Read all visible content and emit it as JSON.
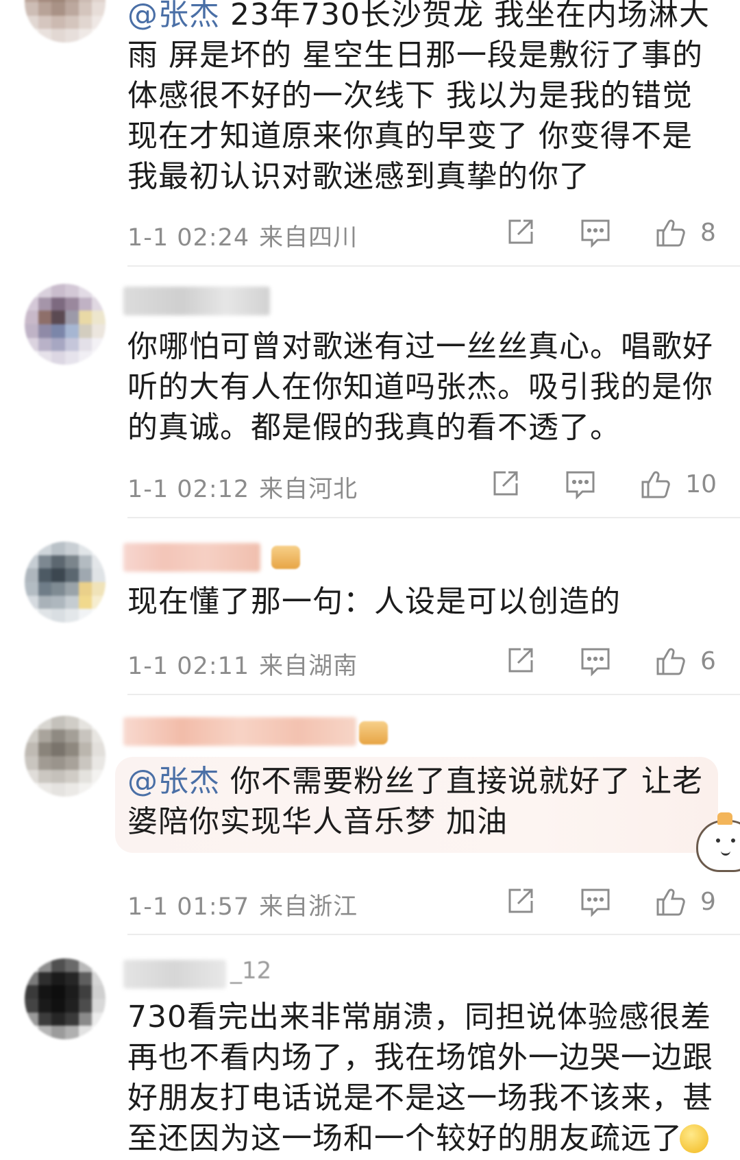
{
  "comments": [
    {
      "mention": "@张杰",
      "text": " 23年730长沙贺龙 我坐在内场淋大雨 屏是坏的 星空生日那一段是敷衍了事的体感很不好的一次线下 我以为是我的错觉现在才知道原来你真的早变了 你变得不是我最初认识对歌迷感到真挚的你了",
      "time": "1-1 02:24",
      "location": "来自四川",
      "likes": "8"
    },
    {
      "mention": "",
      "text": "你哪怕可曾对歌迷有过一丝丝真心。唱歌好听的大有人在你知道吗张杰。吸引我的是你的真诚。都是假的我真的看不透了。",
      "time": "1-1 02:12",
      "location": "来自河北",
      "likes": "10"
    },
    {
      "mention": "",
      "text": "现在懂了那一句：人设是可以创造的",
      "time": "1-1 02:11",
      "location": "来自湖南",
      "likes": "6"
    },
    {
      "mention": "@张杰",
      "text": " 你不需要粉丝了直接说就好了 让老婆陪你实现华人音乐梦 加油",
      "time": "1-1 01:57",
      "location": "来自浙江",
      "likes": "9"
    },
    {
      "mention": "",
      "username_suffix": "_12",
      "text": "730看完出来非常崩溃，同担说体验感很差再也不看内场了，我在场馆外一边哭一边跟好朋友打电话说是不是这一场我不该来，甚至还因为这一场和一个较好的朋友疏远了",
      "time": "",
      "location": "",
      "likes": ""
    }
  ],
  "icons": {
    "repost": "repost-icon",
    "comment": "comment-icon",
    "like": "thumbs-up-icon"
  },
  "colors": {
    "mention": "#4a6fa6",
    "meta": "#8c8c8c",
    "text": "#1c1c1c"
  }
}
